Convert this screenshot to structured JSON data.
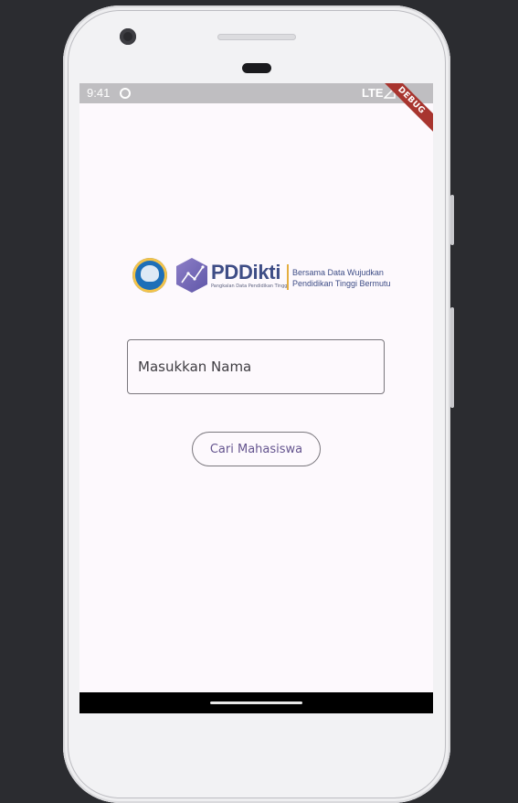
{
  "status_bar": {
    "time": "9:41",
    "network": "LTE"
  },
  "debug_banner": {
    "label": "DEBUG"
  },
  "logo": {
    "title": "PDDikti",
    "subtitle": "Pangkalan Data Pendidikan Tinggi",
    "tagline_line1": "Bersama Data Wujudkan",
    "tagline_line2": "Pendidikan Tinggi Bermutu"
  },
  "search": {
    "placeholder": "Masukkan Nama",
    "value": ""
  },
  "actions": {
    "search_button_label": "Cari Mahasiswa"
  },
  "colors": {
    "accent": "#65558f",
    "brand_navy": "#3e4d86",
    "brand_gold": "#e4ae3f",
    "debug_banner": "#a8352f",
    "status_bar": "#bfbec1",
    "screen_background": "#fdf9fd"
  }
}
